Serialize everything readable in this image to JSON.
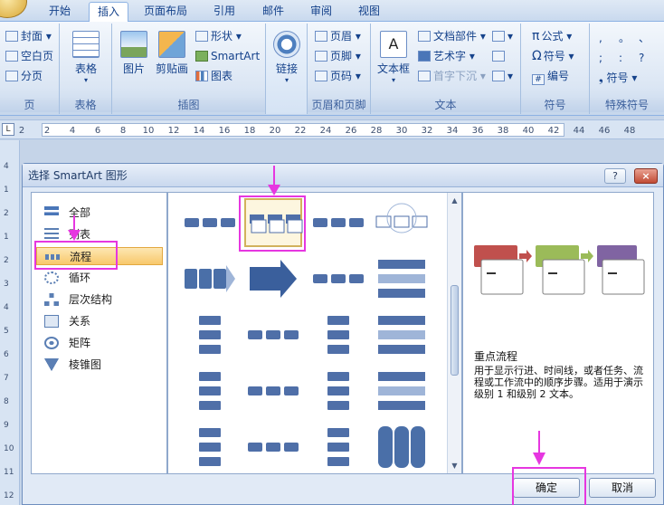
{
  "tabs": [
    "开始",
    "插入",
    "页面布局",
    "引用",
    "邮件",
    "审阅",
    "视图"
  ],
  "active_tab": "插入",
  "ribbon": {
    "pages": {
      "label": "页",
      "items": [
        "封面",
        "空白页",
        "分页"
      ]
    },
    "table": {
      "label": "表格",
      "button": "表格"
    },
    "illustrations": {
      "label": "插图",
      "buttons": [
        "图片",
        "剪贴画"
      ],
      "items": [
        "形状",
        "SmartArt",
        "图表"
      ]
    },
    "links": {
      "label": "",
      "button": "链接"
    },
    "header_footer": {
      "label": "页眉和页脚",
      "items": [
        "页眉",
        "页脚",
        "页码"
      ]
    },
    "text": {
      "label": "文本",
      "button": "文本框",
      "items": [
        "文档部件",
        "艺术字",
        "首字下沉"
      ]
    },
    "symbols": {
      "label": "符号",
      "items": [
        "公式",
        "符号",
        "编号"
      ]
    },
    "special": {
      "label": "特殊符号",
      "items": [
        ",",
        "。",
        "、",
        ";",
        ":",
        "?",
        "符号"
      ]
    }
  },
  "ruler": [
    "2",
    "2",
    "4",
    "6",
    "8",
    "10",
    "12",
    "14",
    "16",
    "18",
    "20",
    "22",
    "24",
    "26",
    "28",
    "30",
    "32",
    "34",
    "36",
    "38",
    "40",
    "42",
    "44",
    "46",
    "48"
  ],
  "vruler": [
    "4",
    "1",
    "2",
    "1",
    "2",
    "3",
    "4",
    "5",
    "6",
    "7",
    "8",
    "9",
    "10",
    "11",
    "12"
  ],
  "dialog": {
    "title": "选择 SmartArt 图形",
    "help": "?",
    "close": "×",
    "categories": [
      "全部",
      "列表",
      "流程",
      "循环",
      "层次结构",
      "关系",
      "矩阵",
      "棱锥图"
    ],
    "selected_category": "流程",
    "preview_title": "重点流程",
    "preview_desc": "用于显示行进、时间线，或者任务、流程或工作流中的顺序步骤。适用于演示级别 1 和级别 2 文本。",
    "ok": "确定",
    "cancel": "取消"
  },
  "colors": {
    "highlight": "#e637e0",
    "accent_red": "#c0504d",
    "accent_green": "#9bbb59",
    "accent_purple": "#8064a2",
    "smartart_blue": "#4f6fa8"
  }
}
